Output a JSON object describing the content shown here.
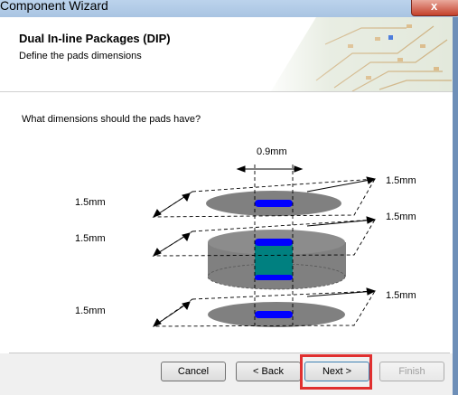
{
  "window": {
    "title": "Component Wizard",
    "close_glyph": "x"
  },
  "header": {
    "title": "Dual In-line Packages (DIP)",
    "subtitle": "Define the pads dimensions"
  },
  "question": "What dimensions should the pads have?",
  "dimensions": {
    "hole_width": "0.9mm",
    "left_top": "1.5mm",
    "left_middle": "1.5mm",
    "left_bottom": "1.5mm",
    "right_top": "1.5mm",
    "right_middle": "1.5mm",
    "right_bottom": "1.5mm"
  },
  "buttons": {
    "cancel": "Cancel",
    "back": "< Back",
    "next": "Next >",
    "finish": "Finish"
  },
  "colors": {
    "pad": "#808080",
    "hole": "#0000ff",
    "barrel": "#008080",
    "highlight": "#e03030"
  },
  "icons": [
    "close-icon",
    "pcb-banner-image",
    "dimension-arrow-icon"
  ]
}
